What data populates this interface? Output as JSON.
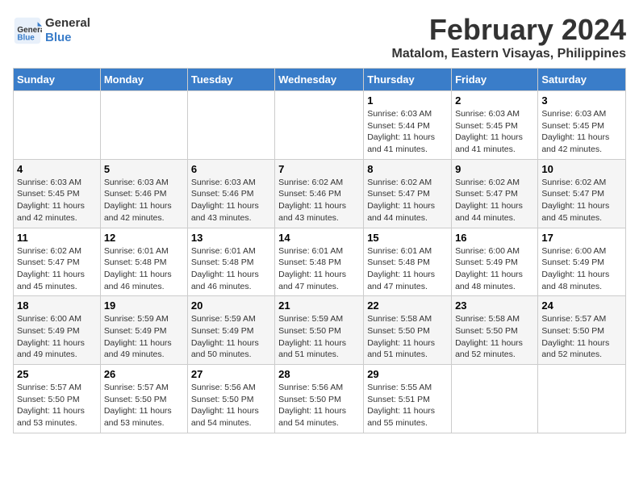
{
  "logo": {
    "line1": "General",
    "line2": "Blue"
  },
  "title": "February 2024",
  "subtitle": "Matalom, Eastern Visayas, Philippines",
  "days_of_week": [
    "Sunday",
    "Monday",
    "Tuesday",
    "Wednesday",
    "Thursday",
    "Friday",
    "Saturday"
  ],
  "weeks": [
    [
      {
        "day": "",
        "info": ""
      },
      {
        "day": "",
        "info": ""
      },
      {
        "day": "",
        "info": ""
      },
      {
        "day": "",
        "info": ""
      },
      {
        "day": "1",
        "info": "Sunrise: 6:03 AM\nSunset: 5:44 PM\nDaylight: 11 hours\nand 41 minutes."
      },
      {
        "day": "2",
        "info": "Sunrise: 6:03 AM\nSunset: 5:45 PM\nDaylight: 11 hours\nand 41 minutes."
      },
      {
        "day": "3",
        "info": "Sunrise: 6:03 AM\nSunset: 5:45 PM\nDaylight: 11 hours\nand 42 minutes."
      }
    ],
    [
      {
        "day": "4",
        "info": "Sunrise: 6:03 AM\nSunset: 5:45 PM\nDaylight: 11 hours\nand 42 minutes."
      },
      {
        "day": "5",
        "info": "Sunrise: 6:03 AM\nSunset: 5:46 PM\nDaylight: 11 hours\nand 42 minutes."
      },
      {
        "day": "6",
        "info": "Sunrise: 6:03 AM\nSunset: 5:46 PM\nDaylight: 11 hours\nand 43 minutes."
      },
      {
        "day": "7",
        "info": "Sunrise: 6:02 AM\nSunset: 5:46 PM\nDaylight: 11 hours\nand 43 minutes."
      },
      {
        "day": "8",
        "info": "Sunrise: 6:02 AM\nSunset: 5:47 PM\nDaylight: 11 hours\nand 44 minutes."
      },
      {
        "day": "9",
        "info": "Sunrise: 6:02 AM\nSunset: 5:47 PM\nDaylight: 11 hours\nand 44 minutes."
      },
      {
        "day": "10",
        "info": "Sunrise: 6:02 AM\nSunset: 5:47 PM\nDaylight: 11 hours\nand 45 minutes."
      }
    ],
    [
      {
        "day": "11",
        "info": "Sunrise: 6:02 AM\nSunset: 5:47 PM\nDaylight: 11 hours\nand 45 minutes."
      },
      {
        "day": "12",
        "info": "Sunrise: 6:01 AM\nSunset: 5:48 PM\nDaylight: 11 hours\nand 46 minutes."
      },
      {
        "day": "13",
        "info": "Sunrise: 6:01 AM\nSunset: 5:48 PM\nDaylight: 11 hours\nand 46 minutes."
      },
      {
        "day": "14",
        "info": "Sunrise: 6:01 AM\nSunset: 5:48 PM\nDaylight: 11 hours\nand 47 minutes."
      },
      {
        "day": "15",
        "info": "Sunrise: 6:01 AM\nSunset: 5:48 PM\nDaylight: 11 hours\nand 47 minutes."
      },
      {
        "day": "16",
        "info": "Sunrise: 6:00 AM\nSunset: 5:49 PM\nDaylight: 11 hours\nand 48 minutes."
      },
      {
        "day": "17",
        "info": "Sunrise: 6:00 AM\nSunset: 5:49 PM\nDaylight: 11 hours\nand 48 minutes."
      }
    ],
    [
      {
        "day": "18",
        "info": "Sunrise: 6:00 AM\nSunset: 5:49 PM\nDaylight: 11 hours\nand 49 minutes."
      },
      {
        "day": "19",
        "info": "Sunrise: 5:59 AM\nSunset: 5:49 PM\nDaylight: 11 hours\nand 49 minutes."
      },
      {
        "day": "20",
        "info": "Sunrise: 5:59 AM\nSunset: 5:49 PM\nDaylight: 11 hours\nand 50 minutes."
      },
      {
        "day": "21",
        "info": "Sunrise: 5:59 AM\nSunset: 5:50 PM\nDaylight: 11 hours\nand 51 minutes."
      },
      {
        "day": "22",
        "info": "Sunrise: 5:58 AM\nSunset: 5:50 PM\nDaylight: 11 hours\nand 51 minutes."
      },
      {
        "day": "23",
        "info": "Sunrise: 5:58 AM\nSunset: 5:50 PM\nDaylight: 11 hours\nand 52 minutes."
      },
      {
        "day": "24",
        "info": "Sunrise: 5:57 AM\nSunset: 5:50 PM\nDaylight: 11 hours\nand 52 minutes."
      }
    ],
    [
      {
        "day": "25",
        "info": "Sunrise: 5:57 AM\nSunset: 5:50 PM\nDaylight: 11 hours\nand 53 minutes."
      },
      {
        "day": "26",
        "info": "Sunrise: 5:57 AM\nSunset: 5:50 PM\nDaylight: 11 hours\nand 53 minutes."
      },
      {
        "day": "27",
        "info": "Sunrise: 5:56 AM\nSunset: 5:50 PM\nDaylight: 11 hours\nand 54 minutes."
      },
      {
        "day": "28",
        "info": "Sunrise: 5:56 AM\nSunset: 5:50 PM\nDaylight: 11 hours\nand 54 minutes."
      },
      {
        "day": "29",
        "info": "Sunrise: 5:55 AM\nSunset: 5:51 PM\nDaylight: 11 hours\nand 55 minutes."
      },
      {
        "day": "",
        "info": ""
      },
      {
        "day": "",
        "info": ""
      }
    ]
  ]
}
